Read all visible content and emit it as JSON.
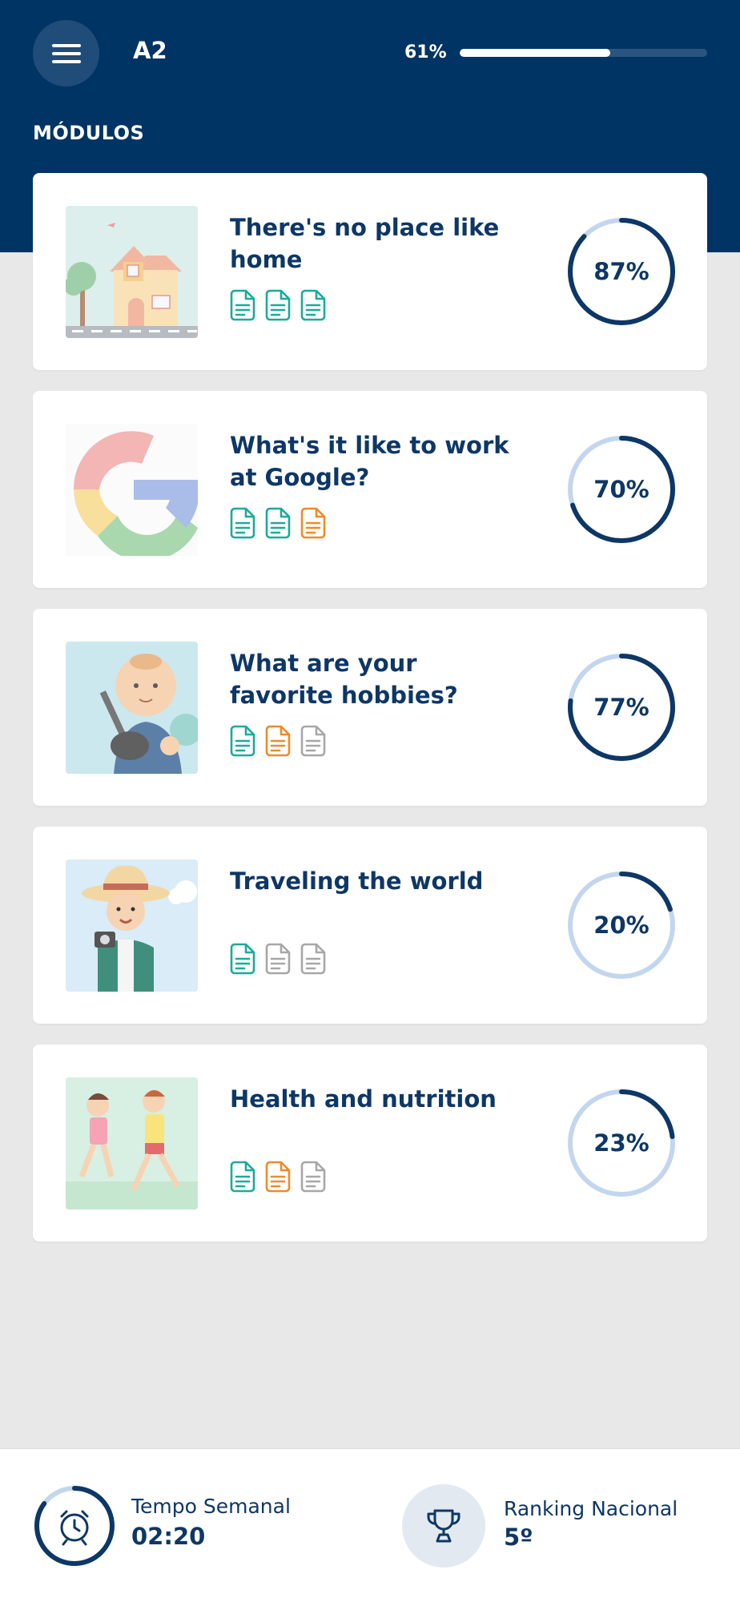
{
  "header": {
    "level": "A2",
    "progress_label": "61%",
    "progress_value": 0.61,
    "section_title": "MÓDULOS"
  },
  "colors": {
    "navy": "#003465",
    "ring_done": "#0d3766",
    "ring_remaining": "#c3d6ef",
    "doc_done": "#1aab9b",
    "doc_partial": "#f08a2a",
    "doc_todo": "#a7a7a7"
  },
  "modules": [
    {
      "title": "There's no place like home",
      "percent_label": "87%",
      "percent": 87,
      "docs": [
        "doc-done-icon",
        "doc-done-icon",
        "doc-done-icon"
      ],
      "thumb": "house-illustration"
    },
    {
      "title": "What's it like to work at Google?",
      "percent_label": "70%",
      "percent": 70,
      "docs": [
        "doc-done-icon",
        "doc-done-icon",
        "doc-partial-icon"
      ],
      "thumb": "google-logo"
    },
    {
      "title": "What are your favorite hobbies?",
      "percent_label": "77%",
      "percent": 77,
      "docs": [
        "doc-done-icon",
        "doc-partial-icon",
        "doc-todo-icon"
      ],
      "thumb": "guitar-player-illustration"
    },
    {
      "title": "Traveling the world",
      "percent_label": "20%",
      "percent": 20,
      "docs": [
        "doc-done-icon",
        "doc-todo-icon",
        "doc-todo-icon"
      ],
      "thumb": "traveler-illustration"
    },
    {
      "title": "Health and nutrition",
      "percent_label": "23%",
      "percent": 23,
      "docs": [
        "doc-done-icon",
        "doc-partial-icon",
        "doc-todo-icon"
      ],
      "thumb": "runners-illustration"
    }
  ],
  "footer": {
    "weekly_time_label": "Tempo Semanal",
    "weekly_time_value": "02:20",
    "weekly_time_progress": 0.85,
    "ranking_label": "Ranking Nacional",
    "ranking_value": "5º"
  }
}
